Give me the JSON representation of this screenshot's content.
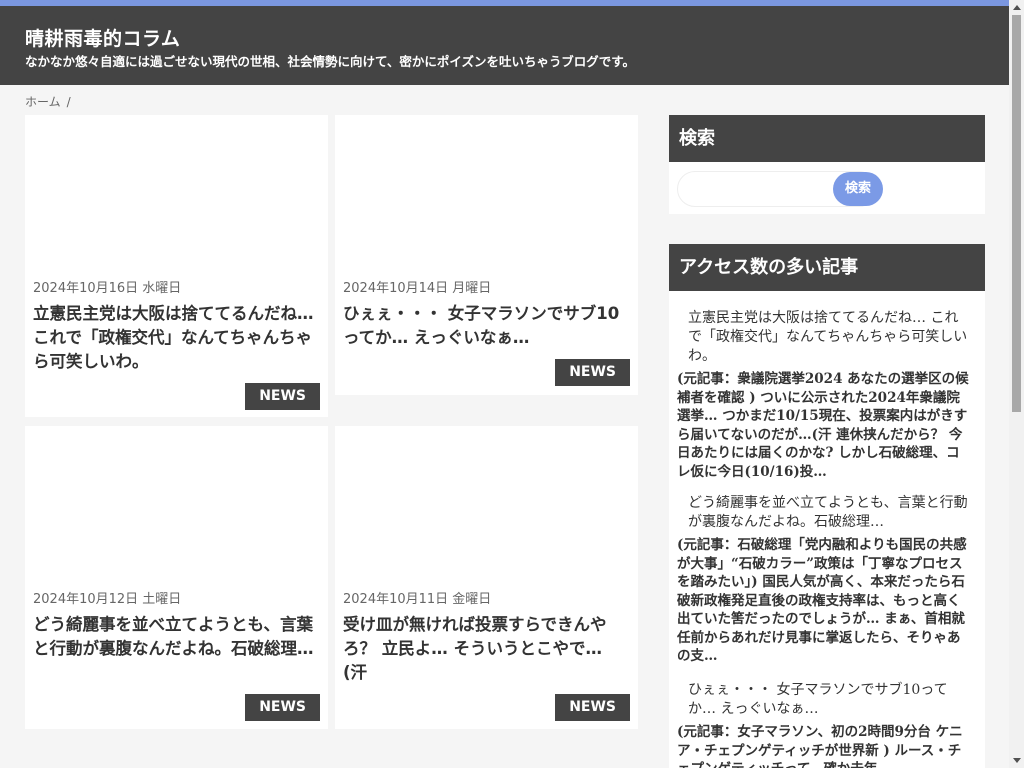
{
  "header": {
    "title": "晴耕雨毒的コラム",
    "description": "なかなか悠々自適には過ごせない現代の世相、社会情勢に向けて、密かにポイズンを吐いちゃうブログです。"
  },
  "breadcrumb": {
    "home": "ホーム",
    "separator": "/"
  },
  "posts": [
    {
      "date": "2024年10月16日 水曜日",
      "title": "立憲民主党は大阪は捨ててるんだね… これで「政権交代」なんてちゃんちゃら可笑しいわ。",
      "category": "NEWS"
    },
    {
      "date": "2024年10月14日 月曜日",
      "title": "ひぇぇ・・・ 女子マラソンでサブ10ってか… えっぐいなぁ…",
      "category": "NEWS"
    },
    {
      "date": "2024年10月12日 土曜日",
      "title": "どう綺麗事を並べ立てようとも、言葉と行動が裏腹なんだよね。石破総理…",
      "category": "NEWS"
    },
    {
      "date": "2024年10月11日 金曜日",
      "title": "受け皿が無ければ投票すらできんやろ？ 立民よ… そういうとこやで… (汗",
      "category": "NEWS"
    }
  ],
  "sidebar": {
    "search": {
      "heading": "検索",
      "placeholder": "",
      "button": "検索"
    },
    "popular": {
      "heading": "アクセス数の多い記事",
      "items": [
        {
          "title": "立憲民主党は大阪は捨ててるんだね… これで「政権交代」なんてちゃんちゃら可笑しいわ。",
          "excerpt": "(元記事：衆議院選挙2024 あなたの選挙区の候補者を確認 ) ついに公示された2024年衆議院選挙… つかまだ10/15現在、投票案内はがきすら届いてないのだが…(汗 連休挟んだから？ 今日あたりには届くのかな? しかし石破総理、コレ仮に今日(10/16)投…"
        },
        {
          "title": "どう綺麗事を並べ立てようとも、言葉と行動が裏腹なんだよね。石破総理…",
          "excerpt": "(元記事：石破総理「党内融和よりも国民の共感が大事」“石破カラー”政策は「丁寧なプロセスを踏みたい」) 国民人気が高く、本来だったら石破新政権発足直後の政権支持率は、もっと高く出ていた筈だったのでしょうが… まぁ、首相就任前からあれだけ見事に掌返したら、そりゃあの支…"
        },
        {
          "title": "ひぇぇ・・・ 女子マラソンでサブ10ってか… えっぐいなぁ…",
          "excerpt": "(元記事：女子マラソン、初の2時間9分台 ケニア・チェプンゲティッチが世界新 ) ルース・チェプンゲティッチって、確か去年"
        }
      ]
    }
  },
  "colors": {
    "accent": "#7b97e0",
    "header_bg": "#444444",
    "page_bg": "#f5f5f5"
  }
}
